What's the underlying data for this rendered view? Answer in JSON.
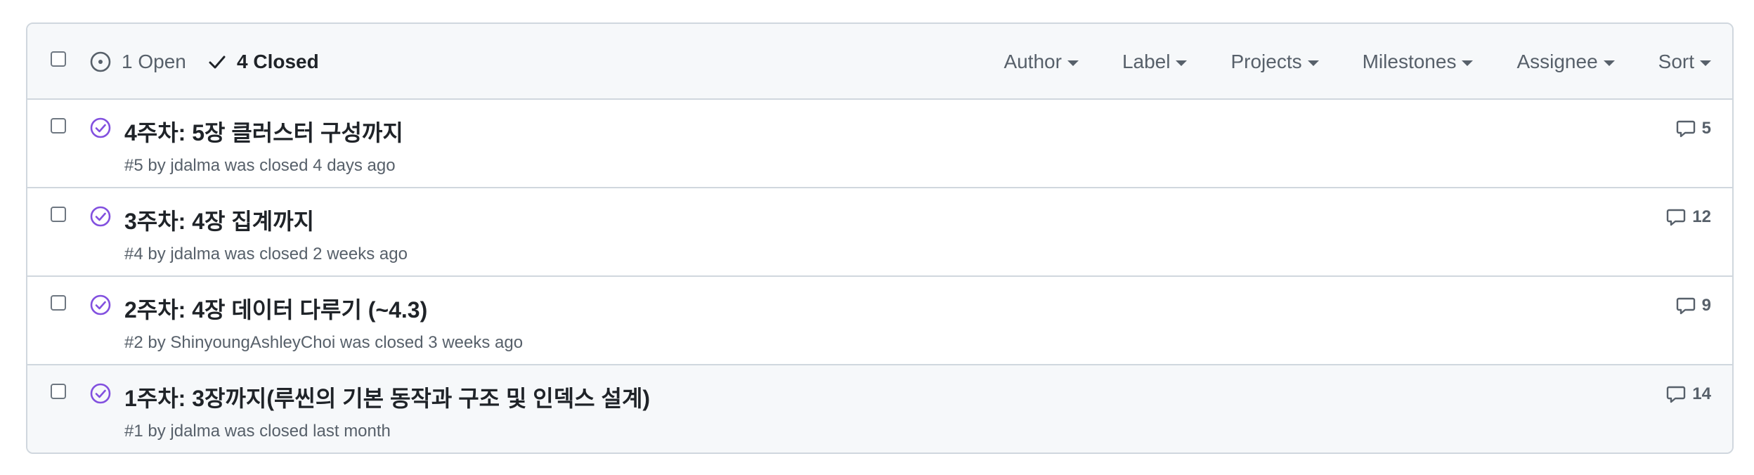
{
  "header": {
    "open_label": "1 Open",
    "closed_label": "4 Closed",
    "filters": [
      "Author",
      "Label",
      "Projects",
      "Milestones",
      "Assignee",
      "Sort"
    ]
  },
  "colors": {
    "closed_icon": "#8250df",
    "border": "#d0d7de",
    "header_bg": "#f6f8fa",
    "muted_text": "#57606a"
  },
  "issues": [
    {
      "title": "4주차: 5장 클러스터 구성까지",
      "number": "#5",
      "by": "by",
      "author": "jdalma",
      "closed_text": "was closed 4 days ago",
      "comments": "5",
      "icon": "check-circle-icon"
    },
    {
      "title": "3주차: 4장 집계까지",
      "number": "#4",
      "by": "by",
      "author": "jdalma",
      "closed_text": "was closed 2 weeks ago",
      "comments": "12",
      "icon": "check-circle-icon"
    },
    {
      "title": "2주차: 4장 데이터 다루기 (~4.3)",
      "number": "#2",
      "by": "by",
      "author": "ShinyoungAshleyChoi",
      "closed_text": "was closed 3 weeks ago",
      "comments": "9",
      "icon": "check-circle-icon"
    },
    {
      "title": "1주차: 3장까지(루씬의 기본 동작과 구조 및 인덱스 설계)",
      "number": "#1",
      "by": "by",
      "author": "jdalma",
      "closed_text": "was closed last month",
      "comments": "14",
      "icon": "check-circle-icon"
    }
  ]
}
